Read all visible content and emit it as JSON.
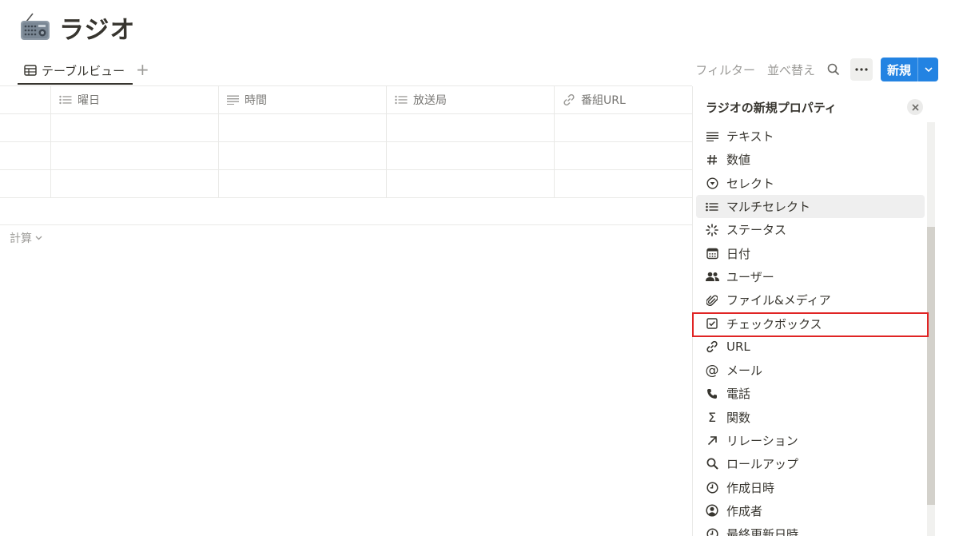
{
  "page": {
    "title": "ラジオ",
    "icon": "radio-icon"
  },
  "views": {
    "active_tab": "テーブルビュー",
    "add_symbol": "+"
  },
  "toolbar": {
    "filter_label": "フィルター",
    "sort_label": "並べ替え",
    "new_label": "新規"
  },
  "table": {
    "columns": [
      {
        "label": "",
        "icon": ""
      },
      {
        "label": "曜日",
        "icon": "list-icon"
      },
      {
        "label": "時間",
        "icon": "text-lines-icon"
      },
      {
        "label": "放送局",
        "icon": "list-icon"
      },
      {
        "label": "番組URL",
        "icon": "link-icon"
      }
    ],
    "rows": [
      [
        "",
        "",
        "",
        "",
        ""
      ],
      [
        "",
        "",
        "",
        "",
        ""
      ],
      [
        "",
        "",
        "",
        "",
        ""
      ]
    ],
    "calc_label": "計算"
  },
  "panel": {
    "title": "ラジオの新規プロパティ",
    "items": [
      {
        "label": "テキスト",
        "icon": "text-lines-icon"
      },
      {
        "label": "数値",
        "icon": "hash-icon"
      },
      {
        "label": "セレクト",
        "icon": "select-icon"
      },
      {
        "label": "マルチセレクト",
        "icon": "list-icon"
      },
      {
        "label": "ステータス",
        "icon": "status-icon"
      },
      {
        "label": "日付",
        "icon": "calendar-icon"
      },
      {
        "label": "ユーザー",
        "icon": "people-icon"
      },
      {
        "label": "ファイル&メディア",
        "icon": "paperclip-icon"
      },
      {
        "label": "チェックボックス",
        "icon": "checkbox-icon"
      },
      {
        "label": "URL",
        "icon": "link-icon"
      },
      {
        "label": "メール",
        "icon": "at-icon"
      },
      {
        "label": "電話",
        "icon": "phone-icon"
      },
      {
        "label": "関数",
        "icon": "sigma-icon"
      },
      {
        "label": "リレーション",
        "icon": "arrow-up-right-icon"
      },
      {
        "label": "ロールアップ",
        "icon": "magnifier-icon"
      },
      {
        "label": "作成日時",
        "icon": "clock-icon"
      },
      {
        "label": "作成者",
        "icon": "user-circle-icon"
      },
      {
        "label": "最終更新日時",
        "icon": "clock-icon"
      }
    ],
    "hovered_item": "マルチセレクト",
    "highlighted_item": "チェックボックス"
  },
  "colors": {
    "accent": "#2383e2",
    "highlight": "#e02424",
    "text": "#37352f",
    "muted": "#9b9a97"
  }
}
